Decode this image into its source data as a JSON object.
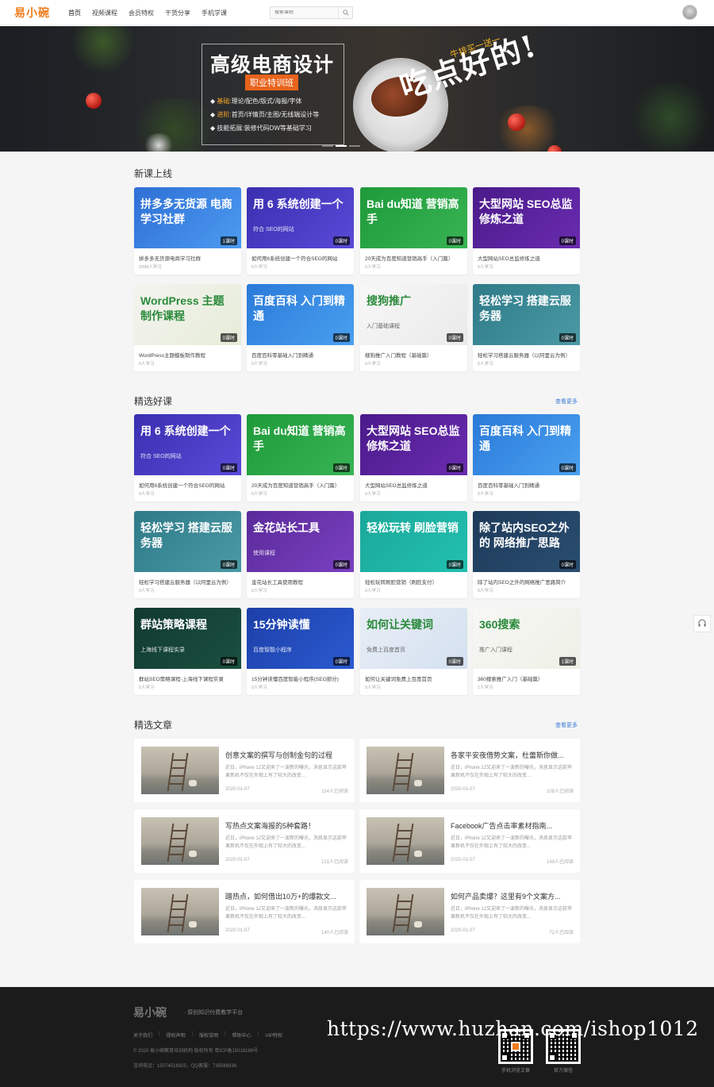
{
  "header": {
    "logo": "易小碗",
    "nav": [
      "首页",
      "视频课程",
      "会员特权",
      "干货分享",
      "手机学课"
    ],
    "search_placeholder": "搜索课程"
  },
  "banner": {
    "title": "高级电商设计",
    "tag": "职业特训班",
    "lines": [
      {
        "key": "基础:",
        "text": "理论/配色/版式/海报/字体"
      },
      {
        "key": "进阶:",
        "text": "首页/详情页/主图/无线端设计等"
      },
      {
        "key": "技能拓展:",
        "text": "装修代码DW等基础学习"
      }
    ],
    "slogan": "吃点好的!",
    "slogan_sub": "牛排买一送一"
  },
  "new_courses": {
    "title": "新课上线",
    "items": [
      {
        "cover_title": "拼多多无货源 电商学习社群",
        "cover_sub": "",
        "badge": "1课时",
        "title": "拼多多无货源电商学习社群",
        "meta": "2098人学习",
        "bg": "#2f6fd6",
        "bg2": "#4c9bf0"
      },
      {
        "cover_title": "用 6 系统创建一个",
        "cover_sub": "符合 SEO的网站",
        "badge": "0课时",
        "title": "如何用6系统创建一个符合SEO的网站",
        "meta": "0人学习",
        "bg": "#3a2fb0",
        "bg2": "#5a4bd8"
      },
      {
        "cover_title": "Bai du知道 营销高手",
        "cover_sub": "",
        "badge": "0课时",
        "title": "20天成为百度知道营销高手（入门篇）",
        "meta": "0人学习",
        "bg": "#1f9a3a",
        "bg2": "#38b454"
      },
      {
        "cover_title": "大型网站 SEO总监修炼之道",
        "cover_sub": "",
        "badge": "0课时",
        "title": "大型网站SEO总监修炼之道",
        "meta": "0人学习",
        "bg": "#4a1a8a",
        "bg2": "#6a2cb0"
      },
      {
        "cover_title": "WordPress 主题制作课程",
        "cover_sub": "",
        "badge": "0课时",
        "title": "WordPress主题模板制作教程",
        "meta": "0人学习",
        "bg": "#f4f4f0",
        "bg2": "#e6ecd8"
      },
      {
        "cover_title": "百度百科 入门到精通",
        "cover_sub": "",
        "badge": "0课时",
        "title": "百度百科零基础入门到精通",
        "meta": "0人学习",
        "bg": "#2a7ad8",
        "bg2": "#4aa0f0"
      },
      {
        "cover_title": "搜狗推广",
        "cover_sub": "入门基础课程",
        "badge": "0课时",
        "title": "搜狗推广入门教程（基础篇）",
        "meta": "0人学习",
        "bg": "#f7f7f7",
        "bg2": "#eaeaea"
      },
      {
        "cover_title": "轻松学习 搭建云服务器",
        "cover_sub": "",
        "badge": "0课时",
        "title": "轻松学习搭建云服务器（以阿里云为例）",
        "meta": "0人学习",
        "bg": "#2f7a88",
        "bg2": "#4a9aa6"
      }
    ]
  },
  "featured": {
    "title": "精选好课",
    "more": "查看更多",
    "items": [
      {
        "cover_title": "用 6 系统创建一个",
        "cover_sub": "符合 SEO的网站",
        "badge": "0课时",
        "title": "如何用6系统创建一个符合SEO的网站",
        "meta": "0人学习",
        "bg": "#3a2fb0",
        "bg2": "#5a4bd8"
      },
      {
        "cover_title": "Bai du知道 营销高手",
        "cover_sub": "",
        "badge": "0课时",
        "title": "20天成为百度知道营销高手（入门篇）",
        "meta": "0人学习",
        "bg": "#1f9a3a",
        "bg2": "#38b454"
      },
      {
        "cover_title": "大型网站 SEO总监修炼之道",
        "cover_sub": "",
        "badge": "0课时",
        "title": "大型网站SEO总监修炼之道",
        "meta": "0人学习",
        "bg": "#4a1a8a",
        "bg2": "#6a2cb0"
      },
      {
        "cover_title": "百度百科 入门到精通",
        "cover_sub": "",
        "badge": "0课时",
        "title": "百度百科零基础入门到精通",
        "meta": "0人学习",
        "bg": "#2a7ad8",
        "bg2": "#4aa0f0"
      },
      {
        "cover_title": "轻松学习 搭建云服务器",
        "cover_sub": "",
        "badge": "0课时",
        "title": "轻松学习搭建云服务器（以阿里云为例）",
        "meta": "0人学习",
        "bg": "#2f7a88",
        "bg2": "#4a9aa6"
      },
      {
        "cover_title": "金花站长工具",
        "cover_sub": "使用课程",
        "badge": "0课时",
        "title": "金花站长工具使用教程",
        "meta": "0人学习",
        "bg": "#5a2a9a",
        "bg2": "#7a40c0"
      },
      {
        "cover_title": "轻松玩转 刷脸营销",
        "cover_sub": "",
        "badge": "0课时",
        "title": "轻松玩转刷脸营销（刷脸支付）",
        "meta": "0人学习",
        "bg": "#1aa89a",
        "bg2": "#22c0b0"
      },
      {
        "cover_title": "除了站内SEO之外的 网络推广思路",
        "cover_sub": "",
        "badge": "0课时",
        "title": "除了站内SEO之外的网络推广思路简介",
        "meta": "0人学习",
        "bg": "#1e3a5a",
        "bg2": "#2a4e70"
      },
      {
        "cover_title": "群站策略课程",
        "cover_sub": "上海线下课程实录",
        "badge": "0课时",
        "title": "群站SEO策略课程-上海线下课程实录",
        "meta": "0人学习",
        "bg": "#123a30",
        "bg2": "#1a5040"
      },
      {
        "cover_title": "15分钟读懂",
        "cover_sub": "百度智能小程序",
        "badge": "0课时",
        "title": "15分钟读懂百度智能小程序(SEO部分)",
        "meta": "0人学习",
        "bg": "#1d3fa8",
        "bg2": "#2a5ad0"
      },
      {
        "cover_title": "如何让关键词",
        "cover_sub": "免费上百度首页",
        "badge": "0课时",
        "title": "如何让关键词免费上百度首页",
        "meta": "0人学习",
        "bg": "#e8eef6",
        "bg2": "#d4e0f0"
      },
      {
        "cover_title": "360搜索",
        "cover_sub": "推广入门课程",
        "badge": "1课时",
        "title": "360搜索推广入门（基础篇）",
        "meta": "1人学习",
        "bg": "#f7f7f4",
        "bg2": "#eef0e6"
      }
    ]
  },
  "articles": {
    "title": "精选文章",
    "more": "查看更多",
    "items": [
      {
        "title": "创意文案的撰写与创制金句的过程",
        "desc": "近日，iPhone 12又迎来了一波新的曝光，消息显示这款苹果新机不仅在外观上有了较大的改变...",
        "date": "2020-01-07",
        "views": "114人已阅读"
      },
      {
        "title": "各家平安夜借势文案，杜蕾斯你做...",
        "desc": "近日，iPhone 12又迎来了一波新的曝光，消息显示这款苹果新机不仅在外观上有了较大的改变...",
        "date": "2020-01-07",
        "views": "108人已阅读"
      },
      {
        "title": "写热点文案海报的5种套路！",
        "desc": "近日，iPhone 12又迎来了一波新的曝光，消息显示这款苹果新机不仅在外观上有了较大的改变...",
        "date": "2020-01-07",
        "views": "121人已阅读"
      },
      {
        "title": "Facebook广告点击率素材指南...",
        "desc": "近日，iPhone 12又迎来了一波新的曝光，消息显示这款苹果新机不仅在外观上有了较大的改变...",
        "date": "2020-01-07",
        "views": "149人已阅读"
      },
      {
        "title": "蹭热点，如何借出10万+的爆款文...",
        "desc": "近日，iPhone 12又迎来了一波新的曝光，消息显示这款苹果新机不仅在外观上有了较大的改变...",
        "date": "2020-01-07",
        "views": "140人已阅读"
      },
      {
        "title": "如何产品卖爆？这里有9个文案方...",
        "desc": "近日，iPhone 12又迎来了一波新的曝光，消息显示这款苹果新机不仅在外观上有了较大的改变...",
        "date": "2020-01-07",
        "views": "72人已阅读"
      }
    ]
  },
  "footer": {
    "logo": "易小碗",
    "slogan": "· 原创知识付费教学平台",
    "links": [
      "关于我们",
      "授权声明",
      "版权说明",
      "帮助中心",
      "VIP特权"
    ],
    "copyright": "© 2020 易小碗教育培训机构 版权所有 粤ICP备15018189号",
    "contact": "咨询电话：15074516925，QQ客服：735566936",
    "qr1_label": "手机浏览文章",
    "qr2_label": "官方微信",
    "watermark": "https://www.huzhan.com/ishop1012"
  },
  "colors": {
    "accent": "#f07c1a",
    "link": "#3a7bd5",
    "footer_bg": "#1b1b1b"
  }
}
